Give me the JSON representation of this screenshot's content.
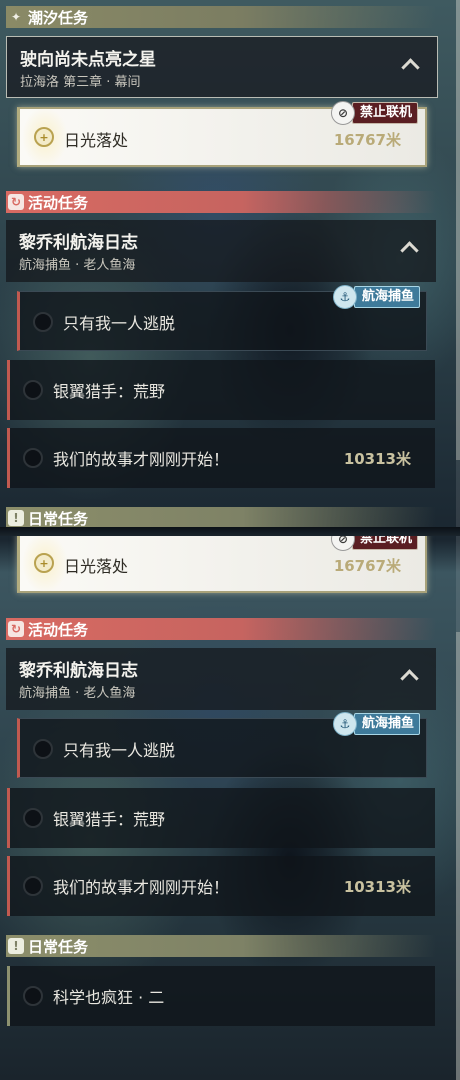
{
  "sections": {
    "tide": {
      "label": "潮汐任务",
      "icon": "sparkle-icon"
    },
    "event": {
      "label": "活动任务",
      "icon": "event-icon"
    },
    "daily": {
      "label": "日常任务",
      "icon": "daily-icon"
    }
  },
  "tide_quest": {
    "title": "驶向尚未点亮之星",
    "subtitle": "拉海洛 第三章 · 幕间"
  },
  "tracked_quest": {
    "name": "日光落处",
    "distance": "16767米",
    "badge": "禁止联机"
  },
  "event_quest": {
    "title": "黎乔利航海日志",
    "subtitle": "航海捕鱼 · 老人鱼海",
    "badge": "航海捕鱼",
    "items": [
      {
        "name": "只有我一人逃脱",
        "distance": ""
      },
      {
        "name": "银翼猎手：荒野",
        "distance": ""
      },
      {
        "name": "我们的故事才刚刚开始！",
        "distance": "10313米"
      }
    ]
  },
  "daily_quest": {
    "items": [
      {
        "name": "科学也疯狂 · 二"
      }
    ]
  },
  "colors": {
    "event_accent": "#d86a62",
    "tide_accent": "#8a8a66",
    "fishing_badge": "#3e7a9a",
    "noonline_badge": "#5a1e22"
  }
}
